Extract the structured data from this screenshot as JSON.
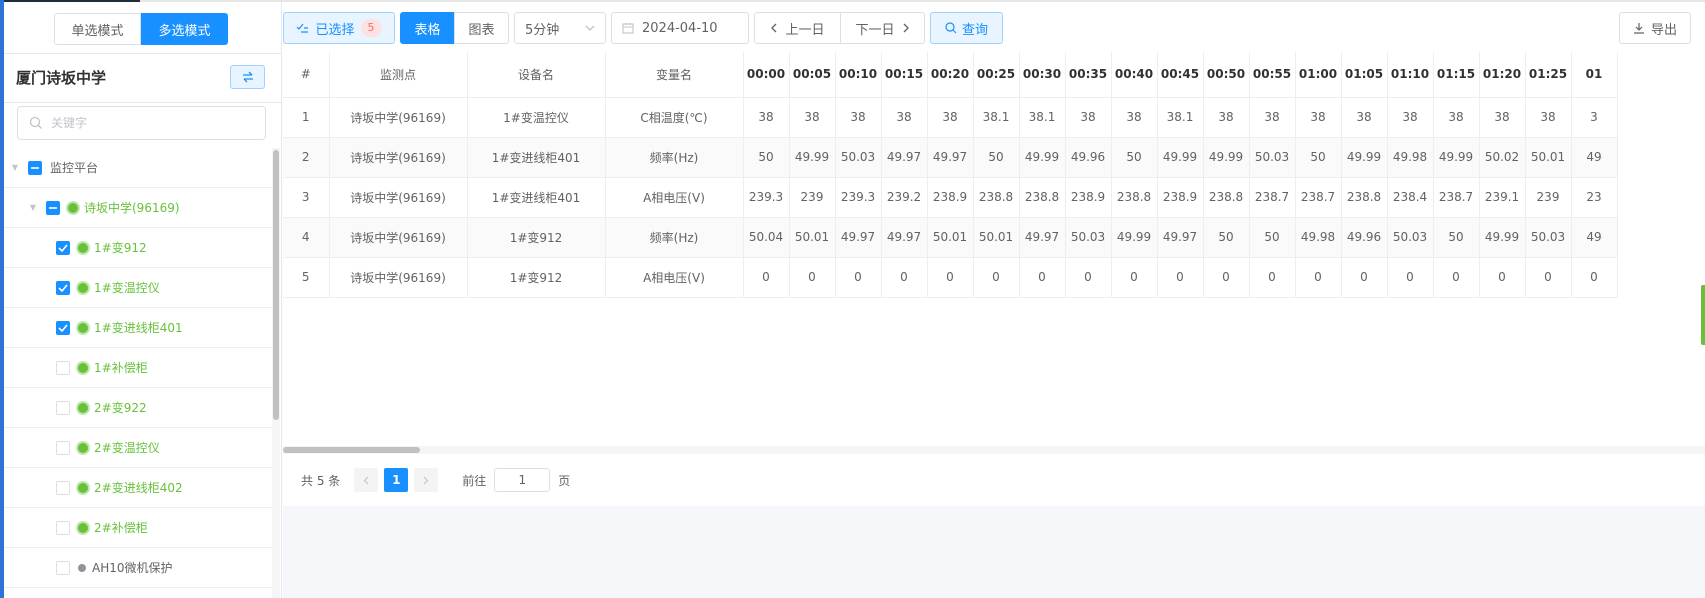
{
  "mode_switch": {
    "single": "单选模式",
    "multi": "多选模式"
  },
  "sidebar": {
    "title": "厦门诗坂中学",
    "search_placeholder": "关键字",
    "tree": [
      {
        "label": "监控平台",
        "level": 0,
        "state": "indeterminate",
        "status": "none"
      },
      {
        "label": "诗坂中学(96169)",
        "level": 1,
        "state": "indeterminate",
        "status": "online"
      },
      {
        "label": "1#变912",
        "level": 2,
        "state": "checked",
        "status": "online"
      },
      {
        "label": "1#变温控仪",
        "level": 2,
        "state": "checked",
        "status": "online"
      },
      {
        "label": "1#变进线柜401",
        "level": 2,
        "state": "checked",
        "status": "online"
      },
      {
        "label": "1#补偿柜",
        "level": 2,
        "state": "unchecked",
        "status": "online"
      },
      {
        "label": "2#变922",
        "level": 2,
        "state": "unchecked",
        "status": "online"
      },
      {
        "label": "2#变温控仪",
        "level": 2,
        "state": "unchecked",
        "status": "online"
      },
      {
        "label": "2#变进线柜402",
        "level": 2,
        "state": "unchecked",
        "status": "online"
      },
      {
        "label": "2#补偿柜",
        "level": 2,
        "state": "unchecked",
        "status": "online"
      },
      {
        "label": "AH10微机保护",
        "level": 2,
        "state": "unchecked",
        "status": "offline"
      }
    ]
  },
  "toolbar": {
    "selected_label": "已选择",
    "selected_count": "5",
    "view_table": "表格",
    "view_chart": "图表",
    "interval": "5分钟",
    "date": "2024-04-10",
    "prev_day": "上一日",
    "next_day": "下一日",
    "query": "查询",
    "export": "导出"
  },
  "table": {
    "headers": [
      "#",
      "监测点",
      "设备名",
      "变量名"
    ],
    "times": [
      "00:00",
      "00:05",
      "00:10",
      "00:15",
      "00:20",
      "00:25",
      "00:30",
      "00:35",
      "00:40",
      "00:45",
      "00:50",
      "00:55",
      "01:00",
      "01:05",
      "01:10",
      "01:15",
      "01:20",
      "01:25",
      "01"
    ],
    "rows": [
      {
        "idx": "1",
        "point": "诗坂中学(96169)",
        "device": "1#变温控仪",
        "variable": "C相温度(℃)",
        "values": [
          "38",
          "38",
          "38",
          "38",
          "38",
          "38.1",
          "38.1",
          "38",
          "38",
          "38.1",
          "38",
          "38",
          "38",
          "38",
          "38",
          "38",
          "38",
          "38",
          "3"
        ]
      },
      {
        "idx": "2",
        "point": "诗坂中学(96169)",
        "device": "1#变进线柜401",
        "variable": "频率(Hz)",
        "values": [
          "50",
          "49.99",
          "50.03",
          "49.97",
          "49.97",
          "50",
          "49.99",
          "49.96",
          "50",
          "49.99",
          "49.99",
          "50.03",
          "50",
          "49.99",
          "49.98",
          "49.99",
          "50.02",
          "50.01",
          "49"
        ]
      },
      {
        "idx": "3",
        "point": "诗坂中学(96169)",
        "device": "1#变进线柜401",
        "variable": "A相电压(V)",
        "values": [
          "239.3",
          "239",
          "239.3",
          "239.2",
          "238.9",
          "238.8",
          "238.8",
          "238.9",
          "238.8",
          "238.9",
          "238.8",
          "238.7",
          "238.7",
          "238.8",
          "238.4",
          "238.7",
          "239.1",
          "239",
          "23"
        ]
      },
      {
        "idx": "4",
        "point": "诗坂中学(96169)",
        "device": "1#变912",
        "variable": "频率(Hz)",
        "values": [
          "50.04",
          "50.01",
          "49.97",
          "49.97",
          "50.01",
          "50.01",
          "49.97",
          "50.03",
          "49.99",
          "49.97",
          "50",
          "50",
          "49.98",
          "49.96",
          "50.03",
          "50",
          "49.99",
          "50.03",
          "49"
        ]
      },
      {
        "idx": "5",
        "point": "诗坂中学(96169)",
        "device": "1#变912",
        "variable": "A相电压(V)",
        "values": [
          "0",
          "0",
          "0",
          "0",
          "0",
          "0",
          "0",
          "0",
          "0",
          "0",
          "0",
          "0",
          "0",
          "0",
          "0",
          "0",
          "0",
          "0",
          "0"
        ]
      }
    ]
  },
  "pagination": {
    "total": "共 5 条",
    "current_page": "1",
    "goto_label": "前往",
    "goto_value": "1",
    "page_suffix": "页"
  }
}
